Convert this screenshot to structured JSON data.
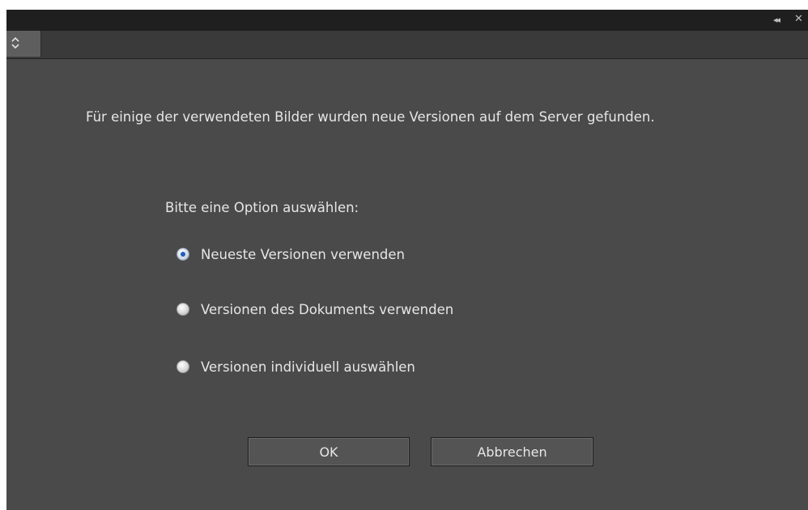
{
  "window": {
    "collapse_glyph": "◂◂",
    "close_glyph": "✕",
    "menu_glyph": "⌃⌄"
  },
  "dialog": {
    "message": "Für einige der verwendeten Bilder wurden neue Versionen auf dem Server gefunden.",
    "prompt": "Bitte eine Option auswählen:",
    "options": [
      {
        "label": "Neueste Versionen verwenden",
        "selected": true
      },
      {
        "label": "Versionen des Dokuments verwenden",
        "selected": false
      },
      {
        "label": "Versionen individuell auswählen",
        "selected": false
      }
    ],
    "buttons": {
      "ok": "OK",
      "cancel": "Abbrechen"
    }
  },
  "colors": {
    "panel_bg": "#4a4a4a",
    "titlebar_bg": "#1f1f1f",
    "text": "#e6e6e6",
    "radio_accent": "#1e5fb8"
  }
}
